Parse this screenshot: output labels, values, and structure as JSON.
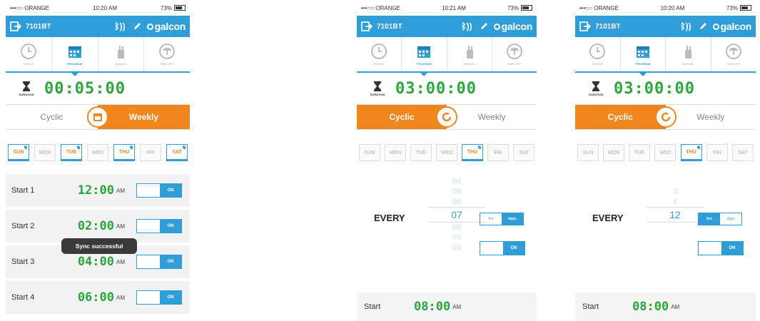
{
  "colors": {
    "accent": "#2f9ed8",
    "orange": "#f0861e",
    "green": "#2aa63a"
  },
  "phones": [
    {
      "status": {
        "carrier": "•••○○ ORANGE",
        "time": "10:20 AM",
        "battery": "73%"
      },
      "device": "7101BT",
      "brand": "galcon",
      "tabs": [
        "STATUS",
        "PROGRAM",
        "MANUAL",
        "RAIN OFF"
      ],
      "duration_label": "DURATION",
      "duration": "00:05:00",
      "mode": {
        "left": "Cyclic",
        "right": "Weekly"
      },
      "days": [
        "SUN",
        "MON",
        "TUE",
        "WED",
        "THU",
        "FRI",
        "SAT"
      ],
      "starts": [
        {
          "label": "Start 1",
          "time": "12:00",
          "ampm": "AM",
          "toggle": "ON"
        },
        {
          "label": "Start 2",
          "time": "02:00",
          "ampm": "AM",
          "toggle": "ON"
        },
        {
          "label": "Start 3",
          "time": "04:00",
          "ampm": "AM",
          "toggle": "ON"
        },
        {
          "label": "Start 4",
          "time": "06:00",
          "ampm": "AM",
          "toggle": "ON"
        }
      ],
      "toast": "Sync successful"
    },
    {
      "status": {
        "carrier": "•••○○ ORANGE",
        "time": "10:21 AM",
        "battery": "73%"
      },
      "device": "7101BT",
      "brand": "galcon",
      "tabs": [
        "STATUS",
        "PROGRAM",
        "MANUAL",
        "RAIN OFF"
      ],
      "duration_label": "DURATION",
      "duration": "03:00:00",
      "mode": {
        "left": "Cyclic",
        "right": "Weekly"
      },
      "days": [
        "SUN",
        "MON",
        "TUE",
        "WED",
        "THU",
        "FRI",
        "SAT"
      ],
      "every_label": "EVERY",
      "picker": [
        "04",
        "05",
        "06",
        "07",
        "08",
        "09",
        "10"
      ],
      "units": [
        "hrs",
        "days"
      ],
      "toggle": "ON",
      "start": {
        "label": "Start",
        "time": "08:00",
        "ampm": "AM"
      }
    },
    {
      "status": {
        "carrier": "•••○○ ORANGE",
        "time": "10:20 AM",
        "battery": "73%"
      },
      "device": "7101BT",
      "brand": "galcon",
      "tabs": [
        "STATUS",
        "PROGRAM",
        "MANUAL",
        "RAIN OFF"
      ],
      "duration_label": "DURATION",
      "duration": "03:00:00",
      "mode": {
        "left": "Cyclic",
        "right": "Weekly"
      },
      "days": [
        "SUN",
        "MON",
        "TUE",
        "WED",
        "THU",
        "FRI",
        "SAT"
      ],
      "every_label": "EVERY",
      "picker": [
        "",
        "3",
        "6",
        "12",
        "",
        "",
        ""
      ],
      "units": [
        "hrs",
        "days"
      ],
      "toggle": "ON",
      "start": {
        "label": "Start",
        "time": "08:00",
        "ampm": "AM"
      }
    }
  ]
}
